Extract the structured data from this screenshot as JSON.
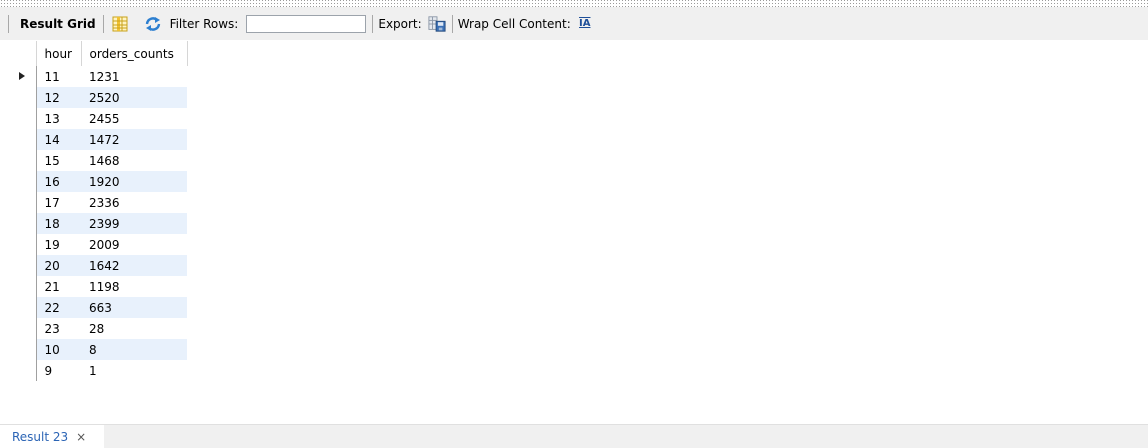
{
  "toolbar": {
    "result_grid_label": "Result Grid",
    "filter_rows_label": "Filter Rows:",
    "filter_value": "",
    "export_label": "Export:",
    "wrap_label": "Wrap Cell Content:",
    "wrap_icon_glyph": "IA"
  },
  "grid": {
    "columns": [
      "hour",
      "orders_counts"
    ],
    "rows": [
      [
        "11",
        "1231"
      ],
      [
        "12",
        "2520"
      ],
      [
        "13",
        "2455"
      ],
      [
        "14",
        "1472"
      ],
      [
        "15",
        "1468"
      ],
      [
        "16",
        "1920"
      ],
      [
        "17",
        "2336"
      ],
      [
        "18",
        "2399"
      ],
      [
        "19",
        "2009"
      ],
      [
        "20",
        "1642"
      ],
      [
        "21",
        "1198"
      ],
      [
        "22",
        "663"
      ],
      [
        "23",
        "28"
      ],
      [
        "10",
        "8"
      ],
      [
        "9",
        "1"
      ]
    ],
    "selected_row": 0
  },
  "tabs": [
    {
      "label": "Result 23",
      "close": "×"
    }
  ],
  "colors": {
    "alt_row": "#e8f1fc",
    "tab_text": "#2b64b5",
    "toolbar_bg": "#f0f0f0"
  }
}
